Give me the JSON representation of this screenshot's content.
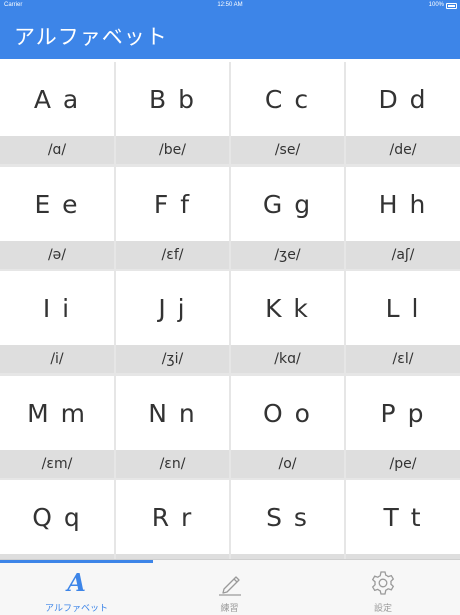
{
  "status_bar": {
    "carrier": "Carrier",
    "time": "12:50 AM",
    "battery": "100%"
  },
  "nav": {
    "title": "アルファベット"
  },
  "letters": [
    {
      "letter": "A a",
      "ipa": "/ɑ/"
    },
    {
      "letter": "B b",
      "ipa": "/be/"
    },
    {
      "letter": "C c",
      "ipa": "/se/"
    },
    {
      "letter": "D d",
      "ipa": "/de/"
    },
    {
      "letter": "E e",
      "ipa": "/ə/"
    },
    {
      "letter": "F f",
      "ipa": "/ɛf/"
    },
    {
      "letter": "G g",
      "ipa": "/ʒe/"
    },
    {
      "letter": "H h",
      "ipa": "/aʃ/"
    },
    {
      "letter": "I i",
      "ipa": "/i/"
    },
    {
      "letter": "J j",
      "ipa": "/ʒi/"
    },
    {
      "letter": "K k",
      "ipa": "/kɑ/"
    },
    {
      "letter": "L l",
      "ipa": "/ɛl/"
    },
    {
      "letter": "M m",
      "ipa": "/ɛm/"
    },
    {
      "letter": "N n",
      "ipa": "/ɛn/"
    },
    {
      "letter": "O o",
      "ipa": "/o/"
    },
    {
      "letter": "P p",
      "ipa": "/pe/"
    },
    {
      "letter": "Q q",
      "ipa": ""
    },
    {
      "letter": "R r",
      "ipa": ""
    },
    {
      "letter": "S s",
      "ipa": ""
    },
    {
      "letter": "T t",
      "ipa": ""
    }
  ],
  "tabs": [
    {
      "label": "アルファベット",
      "icon": "alphabet-icon",
      "glyph": "A",
      "active": true
    },
    {
      "label": "練習",
      "icon": "pencil-icon",
      "active": false
    },
    {
      "label": "設定",
      "icon": "gear-icon",
      "active": false
    }
  ],
  "colors": {
    "accent": "#3d85e8",
    "phonetic_band": "#dedede",
    "inactive": "#9a9a9a"
  }
}
